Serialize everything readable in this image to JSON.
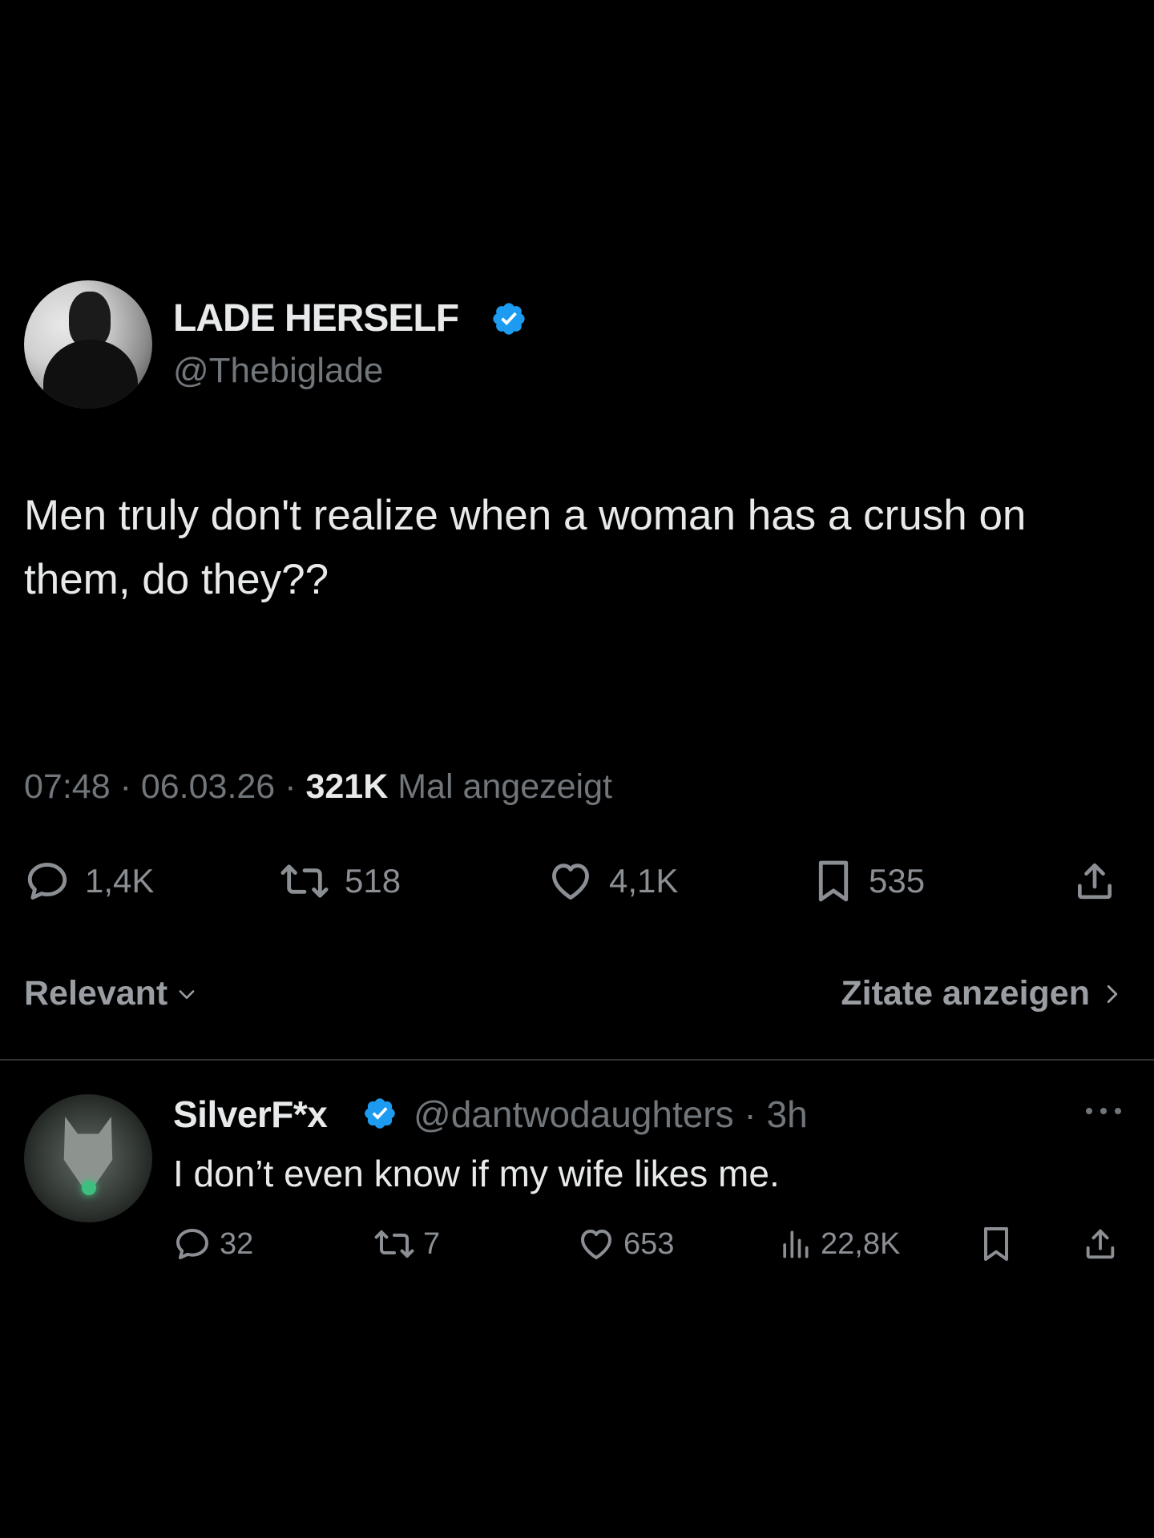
{
  "tweet": {
    "author": {
      "display_name": "LADE HERSELF",
      "handle": "@Thebiglade",
      "verified": true
    },
    "text": "Men truly don't realize when a woman has a crush on them, do they??",
    "meta": {
      "time": "07:48",
      "separator": "·",
      "date": "06.03.26",
      "views_count": "321K",
      "views_label": "Mal angezeigt"
    },
    "actions": {
      "replies": "1,4K",
      "reposts": "518",
      "likes": "4,1K",
      "bookmarks": "535"
    }
  },
  "sort": {
    "label": "Relevant",
    "quotes_label": "Zitate anzeigen"
  },
  "reply": {
    "author": {
      "display_name": "SilverF*x",
      "handle": "@dantwodaughters",
      "verified": true
    },
    "handle_time": "@dantwodaughters · 3h",
    "text": "I don’t even know if my wife likes me.",
    "actions": {
      "replies": "32",
      "reposts": "7",
      "likes": "653",
      "views": "22,8K"
    }
  },
  "colors": {
    "background": "#000000",
    "text": "#e7e9ea",
    "muted": "#71767b",
    "verified": "#1d9bf0",
    "divider": "#2f3336"
  },
  "icons": [
    "reply-icon",
    "repost-icon",
    "like-icon",
    "bookmark-icon",
    "share-icon",
    "views-icon",
    "verified-badge-icon",
    "chevron-down-icon",
    "chevron-right-icon",
    "more-icon"
  ]
}
